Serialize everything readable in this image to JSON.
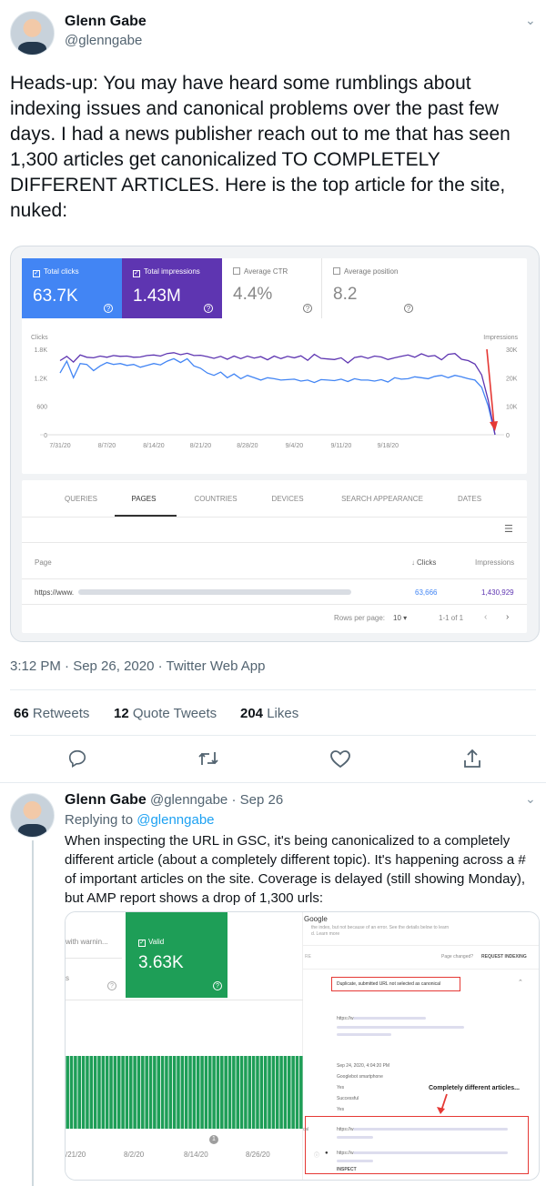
{
  "tweet": {
    "author_name": "Glenn Gabe",
    "author_handle": "@glenngabe",
    "text": "Heads-up: You may have heard some rumblings about indexing issues and canonical problems over the past few days. I had a news publisher reach out to me that has seen 1,300 articles get canonicalized TO COMPLETELY DIFFERENT ARTICLES. Here is the top article for the site, nuked:",
    "timestamp": "3:12 PM · Sep 26, 2020 · Twitter Web App",
    "retweets": "66",
    "retweets_label": "Retweets",
    "quote_tweets": "12",
    "quote_tweets_label": "Quote Tweets",
    "likes": "204",
    "likes_label": "Likes"
  },
  "gsc": {
    "metrics": [
      {
        "label": "Total clicks",
        "value": "63.7K",
        "color": "#4285f4"
      },
      {
        "label": "Total impressions",
        "value": "1.43M",
        "color": "#5e35b1"
      },
      {
        "label": "Average CTR",
        "value": "4.4%"
      },
      {
        "label": "Average position",
        "value": "8.2"
      }
    ],
    "left_axis_title": "Clicks",
    "right_axis_title": "Impressions",
    "tabs": [
      "QUERIES",
      "PAGES",
      "COUNTRIES",
      "DEVICES",
      "SEARCH APPEARANCE",
      "DATES"
    ],
    "table_header_page": "Page",
    "table_header_clicks": "Clicks",
    "table_header_impressions": "Impressions",
    "row_url": "https://www.",
    "row_clicks": "63,666",
    "row_impressions": "1,430,929",
    "rows_per_page_label": "Rows per page:",
    "rows_per_page_value": "10",
    "pagination": "1-1 of 1"
  },
  "chart_data": {
    "type": "line",
    "x_ticks": [
      "7/31/20",
      "8/7/20",
      "8/14/20",
      "8/21/20",
      "8/28/20",
      "9/4/20",
      "9/11/20",
      "9/18/20"
    ],
    "left_ticks": [
      "1.8K",
      "1.2K",
      "600",
      "0"
    ],
    "right_ticks": [
      "30K",
      "20K",
      "10K",
      "0"
    ],
    "left_ylim": [
      0,
      1800
    ],
    "right_ylim": [
      0,
      30000
    ],
    "series": [
      {
        "name": "Clicks",
        "color": "#4285f4",
        "axis": "left",
        "values": [
          1300,
          1550,
          1200,
          1500,
          1480,
          1350,
          1450,
          1520,
          1480,
          1500,
          1460,
          1480,
          1420,
          1460,
          1500,
          1470,
          1550,
          1600,
          1520,
          1600,
          1450,
          1400,
          1300,
          1250,
          1320,
          1200,
          1280,
          1180,
          1250,
          1200,
          1150,
          1200,
          1180,
          1150,
          1160,
          1170,
          1130,
          1150,
          1100,
          1160,
          1150,
          1140,
          1170,
          1120,
          1180,
          1150,
          1150,
          1130,
          1160,
          1110,
          1200,
          1170,
          1180,
          1220,
          1200,
          1180,
          1230,
          1250,
          1200,
          1250,
          1220,
          1180,
          1150,
          1000,
          600,
          0
        ]
      },
      {
        "name": "Impressions",
        "color": "#5e35b1",
        "axis": "right",
        "values": [
          26000,
          27500,
          25500,
          28000,
          27200,
          27000,
          27600,
          27200,
          27800,
          27500,
          27600,
          27200,
          27300,
          27800,
          28000,
          27600,
          28500,
          28800,
          28100,
          28600,
          27800,
          27900,
          27400,
          26800,
          27500,
          26500,
          27600,
          26700,
          27600,
          26900,
          27400,
          26300,
          27600,
          26700,
          27500,
          27000,
          27700,
          26100,
          28200,
          26800,
          26600,
          26400,
          27000,
          25200,
          27100,
          27500,
          26800,
          27600,
          27300,
          26400,
          27000,
          27500,
          28000,
          27200,
          28400,
          27500,
          27800,
          26300,
          28200,
          28500,
          26500,
          26000,
          24800,
          21000,
          12000,
          0
        ]
      }
    ]
  },
  "reply": {
    "author_name": "Glenn Gabe",
    "author_handle": "@glenngabe",
    "date": "Sep 26",
    "replying_prefix": "Replying to",
    "replying_to": "@glenngabe",
    "text": "When inspecting the URL in GSC, it's being canonicalized to a completely different article (about a completely different topic). It's happening across a # of important articles on the site. Coverage is delayed (still showing Monday), but AMP report shows a drop of 1,300 urls:"
  },
  "amp": {
    "with_warning_label": "with warnin...",
    "valid_label": "Valid",
    "valid_value": "3.63K",
    "x_ticks": [
      "/21/20",
      "8/2/20",
      "8/14/20",
      "8/26/20"
    ],
    "badge": "1",
    "color": "#1e9e57"
  },
  "inspect": {
    "brand": "Google",
    "subtitle_line1": "the index, but not because of an error. See the details below to learn",
    "subtitle_line2": "d. Learn more",
    "page_changed": "Page changed?",
    "request_indexing": "REQUEST INDEXING",
    "canonical_status": "Duplicate, submitted URL not selected as canonical",
    "url_prefix_1": "https://www.",
    "crawl_date": "Sep 24, 2020, 4:04:20 PM",
    "crawler": "Googlebot smartphone",
    "yes_1": "Yes",
    "successful": "Successful",
    "yes_2": "Yes",
    "annotation": "Completely different articles...",
    "url_prefix_2": "https://www.",
    "url_prefix_3": "https://www.",
    "inspect_label": "INSPECT",
    "left_cut_label": "cal"
  }
}
